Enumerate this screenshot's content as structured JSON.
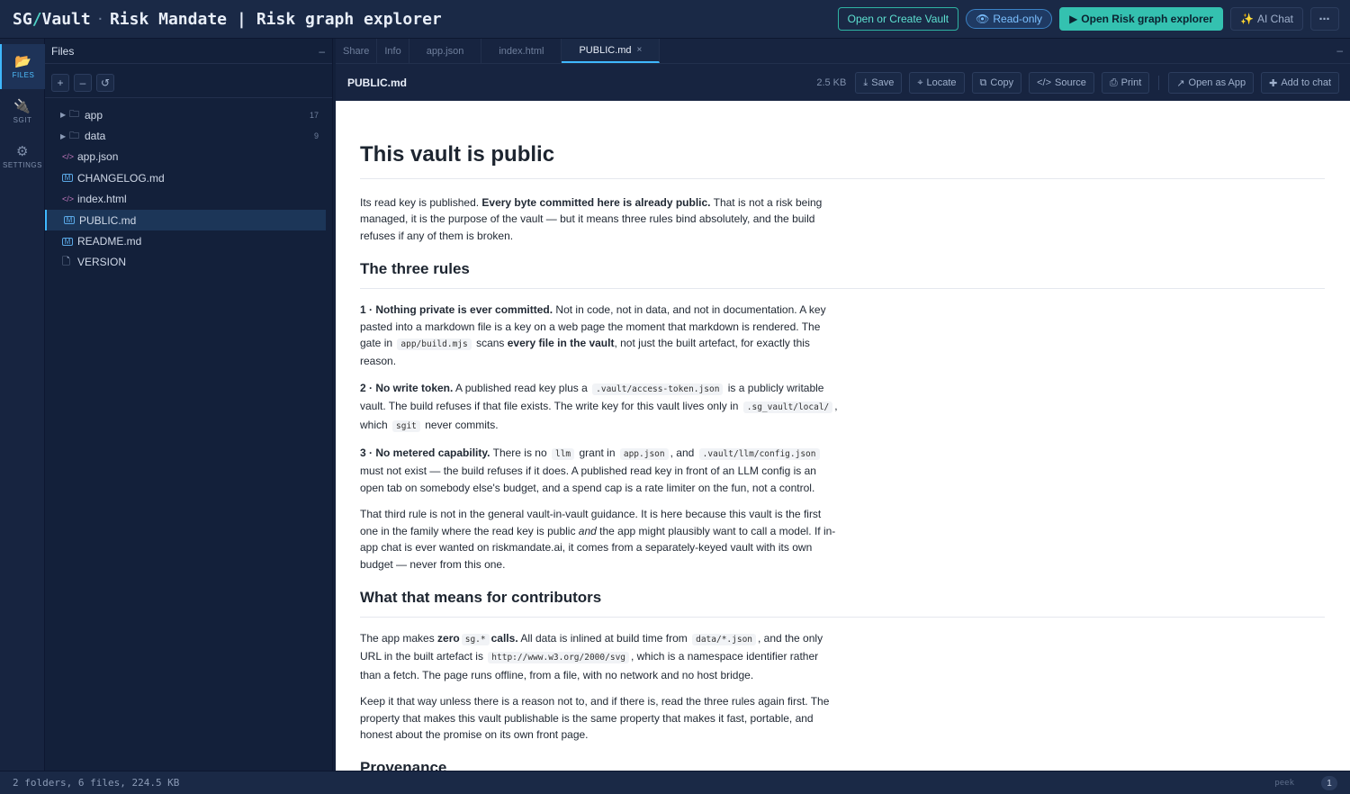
{
  "header": {
    "brand_sg": "SG",
    "brand_slash": "/",
    "brand_vault": "Vault",
    "title_vault": "Risk Mandate",
    "title_sep": "|",
    "title_page": "Risk graph explorer",
    "open_vault_label": "Open or Create Vault",
    "readonly_label": "Read-only",
    "open_explorer_label": "Open Risk graph explorer",
    "ai_chat_label": "AI Chat",
    "more_label": "⋯"
  },
  "rail": {
    "files": "FILES",
    "sgit": "SGIT",
    "settings": "SETTINGS"
  },
  "files_panel": {
    "title": "Files",
    "minimize": "–",
    "tools": {
      "add": "+",
      "remove": "–",
      "refresh": "↺"
    },
    "items": [
      {
        "name": "app",
        "kind": "folder",
        "count": "17"
      },
      {
        "name": "data",
        "kind": "folder",
        "count": "9"
      },
      {
        "name": "app.json",
        "kind": "code"
      },
      {
        "name": "CHANGELOG.md",
        "kind": "md"
      },
      {
        "name": "index.html",
        "kind": "code"
      },
      {
        "name": "PUBLIC.md",
        "kind": "md",
        "selected": true
      },
      {
        "name": "README.md",
        "kind": "md"
      },
      {
        "name": "VERSION",
        "kind": "file"
      }
    ]
  },
  "tabs": {
    "items": [
      "Share",
      "Info",
      "app.json",
      "index.html",
      "PUBLIC.md"
    ],
    "close": "×",
    "minimize": "–"
  },
  "toolbar": {
    "filename": "PUBLIC.md",
    "size": "2.5 KB",
    "save": "Save",
    "locate": "Locate",
    "copy": "Copy",
    "source": "Source",
    "print": "Print",
    "open_as_app": "Open as App",
    "add_to_chat": "Add to chat"
  },
  "document": {
    "h1": "This vault is public",
    "intro": {
      "t1": "Its read key is published. ",
      "b1": "Every byte committed here is already public.",
      "t2": " That is not a risk being managed, it is the purpose of the vault — but it means three rules bind absolutely, and the build refuses if any of them is broken."
    },
    "h2_rules": "The three rules",
    "rule1": {
      "b1": "1 · Nothing private is ever committed.",
      "t1": " Not in code, not in data, and not in documentation. A key pasted into a markdown file is a key on a web page the moment that markdown is rendered. The gate in ",
      "c1": "app/build.mjs",
      "t2": " scans ",
      "b2": "every file in the vault",
      "t3": ", not just the built artefact, for exactly this reason."
    },
    "rule2": {
      "b1": "2 · No write token.",
      "t1": " A published read key plus a ",
      "c1": ".vault/access-token.json",
      "t2": " is a publicly writable vault. The build refuses if that file exists. The write key for this vault lives only in ",
      "c2": ".sg_vault/local/",
      "t3": ", which ",
      "c3": "sgit",
      "t4": " never commits."
    },
    "rule3": {
      "b1": "3 · No metered capability.",
      "t1": " There is no ",
      "c1": "llm",
      "t2": " grant in ",
      "c2": "app.json",
      "t3": ", and ",
      "c3": ".vault/llm/config.json",
      "t4": " must not exist — the build refuses if it does. A published read key in front of an LLM config is an open tab on somebody else's budget, and a spend cap is a rate limiter on the fun, not a control."
    },
    "third": {
      "t1": "That third rule is not in the general vault-in-vault guidance. It is here because this vault is the first one in the family where the read key is public ",
      "i1": "and",
      "t2": " the app might plausibly want to call a model. If in-app chat is ever wanted on riskmandate.ai, it comes from a separately-keyed vault with its own budget — never from this one."
    },
    "h2_contrib": "What that means for contributors",
    "contrib": {
      "t1": "The app makes ",
      "b1": "zero",
      "c1": "sg.*",
      "b2": "calls.",
      "t2": " All data is inlined at build time from ",
      "c2": "data/*.json",
      "t3": ", and the only URL in the built artefact is ",
      "c3": "http://www.w3.org/2000/svg",
      "t4": ", which is a namespace identifier rather than a fetch. The page runs offline, from a file, with no network and no host bridge."
    },
    "keep": "Keep it that way unless there is a reason not to, and if there is, read the three rules again first. The property that makes this vault publishable is the same property that makes it fast, portable, and honest about the promise on its own front page.",
    "h2_prov": "Provenance"
  },
  "status": {
    "summary": "2 folders, 6 files, 224.5 KB",
    "peek": "peek",
    "badge": "1"
  },
  "colors": {
    "accent": "#34c1b0",
    "link": "#3fb8ff",
    "bg": "#13203a"
  }
}
